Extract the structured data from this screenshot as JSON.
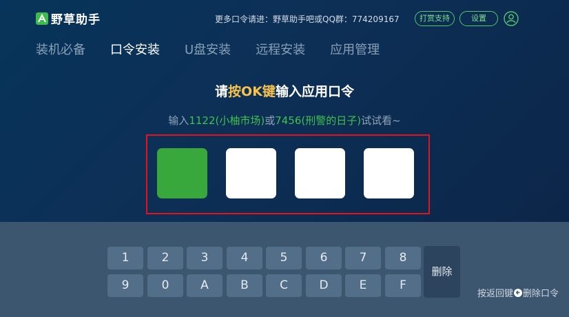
{
  "header": {
    "app_name": "野草助手",
    "qq_text": "更多口令请进：野草助手吧或QQ群：774209167",
    "tip_button": "打赏支持",
    "settings_button": "设置"
  },
  "nav": {
    "tabs": [
      {
        "label": "装机必备",
        "active": false
      },
      {
        "label": "口令安装",
        "active": true
      },
      {
        "label": "U盘安装",
        "active": false
      },
      {
        "label": "远程安装",
        "active": false
      },
      {
        "label": "应用管理",
        "active": false
      }
    ]
  },
  "main": {
    "title_pre": "请",
    "title_hl": "按OK键",
    "title_post": "输入应用口令",
    "hint_pre": "输入",
    "hint_code1": "1122(小柚市场)",
    "hint_mid": "或",
    "hint_code2": "7456(刑警的日子)",
    "hint_post": "试试看~",
    "code_slots": [
      "",
      "",
      "",
      ""
    ]
  },
  "keypad": {
    "row1": [
      "1",
      "2",
      "3",
      "4",
      "5",
      "6",
      "7",
      "8"
    ],
    "row2": [
      "9",
      "0",
      "A",
      "B",
      "C",
      "D",
      "E",
      "F"
    ],
    "delete_label": "删除",
    "back_hint_pre": "按返回键",
    "back_hint_post": "删除口令"
  },
  "colors": {
    "accent_green": "#38a83d",
    "highlight_yellow": "#f7c34a",
    "frame_red": "#e3121b"
  }
}
